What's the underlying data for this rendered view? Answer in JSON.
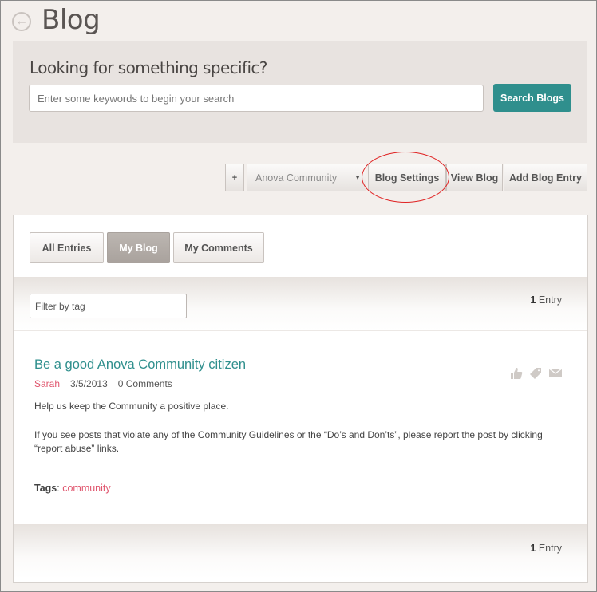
{
  "page": {
    "title": "Blog"
  },
  "search": {
    "heading": "Looking for something specific?",
    "placeholder": "Enter some keywords to begin your search",
    "button_label": "Search Blogs"
  },
  "toolbar": {
    "plus_label": "+",
    "community_select": "Anova Community",
    "settings_label": "Blog Settings",
    "view_label": "View Blog",
    "add_label": "Add Blog Entry"
  },
  "tabs": [
    {
      "label": "All Entries",
      "selected": false
    },
    {
      "label": "My Blog",
      "selected": true
    },
    {
      "label": "My Comments",
      "selected": false
    }
  ],
  "filter": {
    "placeholder": "Filter by tag"
  },
  "entries_count": {
    "number": "1",
    "label": "Entry"
  },
  "post": {
    "title": "Be a good Anova Community citizen",
    "author": "Sarah",
    "date": "3/5/2013",
    "comments": "0 Comments",
    "body": [
      "Help us keep the Community a positive place.",
      "If you see posts that violate any of the Community Guidelines or the “Do’s and Don’ts”, please report the post by clicking “report abuse” links."
    ],
    "tags_label": "Tags",
    "tags": [
      "community"
    ],
    "actions": [
      "thumbs-up-icon",
      "tag-icon",
      "mail-icon"
    ]
  },
  "colors": {
    "accent": "#2f8f8d",
    "link": "#e0566e",
    "highlight": "#e02424"
  }
}
